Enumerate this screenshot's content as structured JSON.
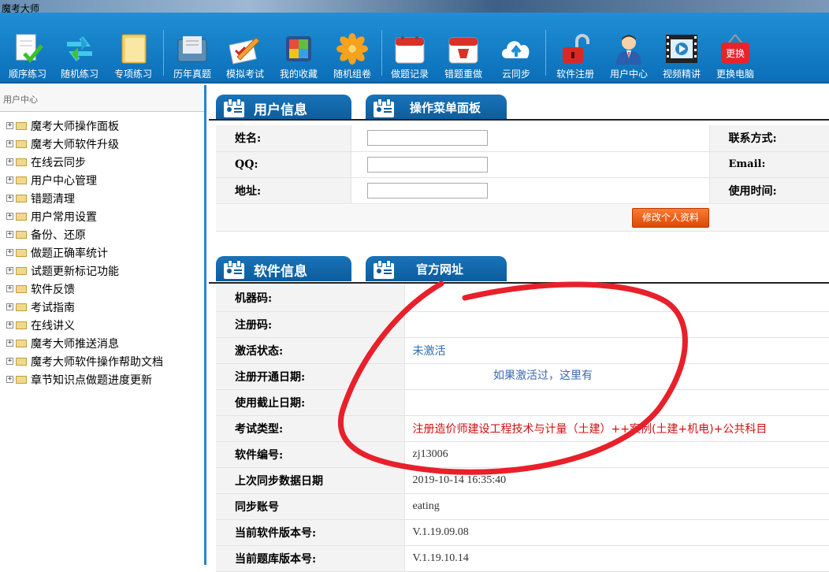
{
  "window": {
    "title": "魔考大师"
  },
  "toolbar": {
    "items": [
      {
        "label": "顺序练习",
        "icon": "document-check-icon"
      },
      {
        "label": "随机练习",
        "icon": "refresh-arrows-icon"
      },
      {
        "label": "专项练习",
        "icon": "folder-icon"
      },
      {
        "label": "历年真题",
        "icon": "archive-icon"
      },
      {
        "label": "模拟考试",
        "icon": "pencil-paper-icon"
      },
      {
        "label": "我的收藏",
        "icon": "collection-icon"
      },
      {
        "label": "随机组卷",
        "icon": "flower-icon"
      },
      {
        "label": "做题记录",
        "icon": "calendar-icon"
      },
      {
        "label": "错题重做",
        "icon": "calendar-redo-icon"
      },
      {
        "label": "云同步",
        "icon": "cloud-upload-icon"
      },
      {
        "label": "软件注册",
        "icon": "unlock-icon"
      },
      {
        "label": "用户中心",
        "icon": "user-icon"
      },
      {
        "label": "视频精讲",
        "icon": "video-film-icon"
      },
      {
        "label": "更换电脑",
        "icon": "sign-icon",
        "sign_text": "更换"
      }
    ]
  },
  "sidebar": {
    "header": "用户中心",
    "items": [
      "魔考大师操作面板",
      "魔考大师软件升级",
      "在线云同步",
      "用户中心管理",
      "错题清理",
      "用户常用设置",
      "备份、还原",
      "做题正确率统计",
      "试题更新标记功能",
      "软件反馈",
      "考试指南",
      "在线讲义",
      "魔考大师推送消息",
      "魔考大师软件操作帮助文档",
      "章节知识点做题进度更新"
    ]
  },
  "user_tabs": [
    "用户信息",
    "操作菜单面板"
  ],
  "user_info": {
    "name_label": "姓名:",
    "qq_label": "QQ:",
    "address_label": "地址:",
    "contact_label": "联系方式:",
    "email_label": "Email:",
    "use_time_label": "使用时间:",
    "edit_button": "修改个人资料"
  },
  "soft_tabs": [
    "软件信息",
    "官方网址"
  ],
  "software_info": [
    {
      "label": "机器码:",
      "value": "",
      "style": "gray"
    },
    {
      "label": "注册码:",
      "value": "",
      "style": "gray"
    },
    {
      "label": "激活状态:",
      "value": "未激活",
      "style": "blue"
    },
    {
      "label": "注册开通日期:",
      "value": "",
      "style": "gray"
    },
    {
      "label": "使用截止日期:",
      "value": "",
      "style": "gray"
    },
    {
      "label": "考试类型:",
      "value": "注册造价师建设工程技术与计量（土建）++案例(土建+机电)+公共科目",
      "style": "red"
    },
    {
      "label": "软件编号:",
      "value": "zj13006",
      "style": "gray"
    },
    {
      "label": "上次同步数据日期",
      "value": "2019-10-14 16:35:40",
      "style": "gray"
    },
    {
      "label": "同步账号",
      "value": "eating",
      "style": "gray"
    },
    {
      "label": "当前软件版本号:",
      "value": "V.1.19.09.08",
      "style": "gray"
    },
    {
      "label": "当前题库版本号:",
      "value": "V.1.19.10.14",
      "style": "gray"
    }
  ],
  "annotation": {
    "note": "如果激活过，这里有",
    "color": "#e8202a"
  }
}
